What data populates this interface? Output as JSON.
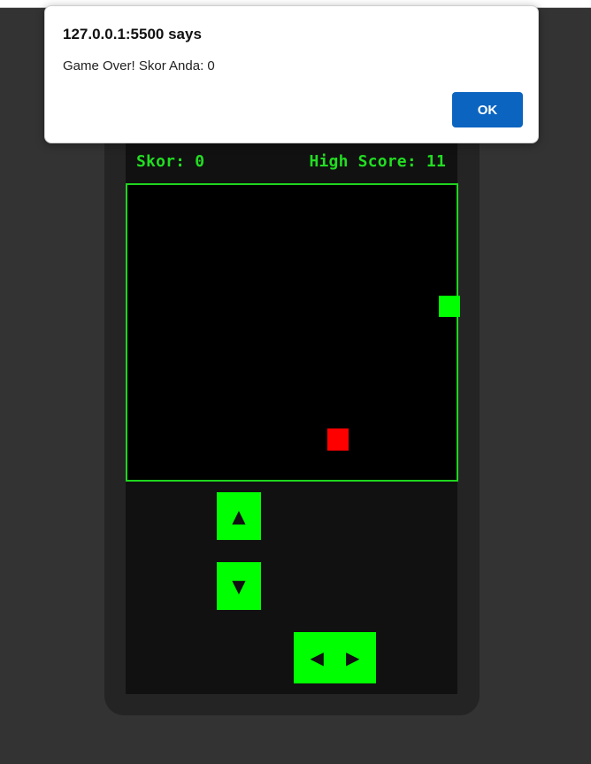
{
  "alert": {
    "title": "127.0.0.1:5500 says",
    "message": "Game Over! Skor Anda: 0",
    "ok_label": "OK",
    "ok_color": "#0b64c0"
  },
  "game": {
    "score_text": "Skor: 0",
    "high_score_text": "High Score: 11",
    "accent_color": "#00ff00",
    "food_color": "#ff0000"
  },
  "controls": {
    "up_icon": "▲",
    "down_icon": "▼",
    "left_icon": "◀",
    "right_icon": "▶"
  }
}
